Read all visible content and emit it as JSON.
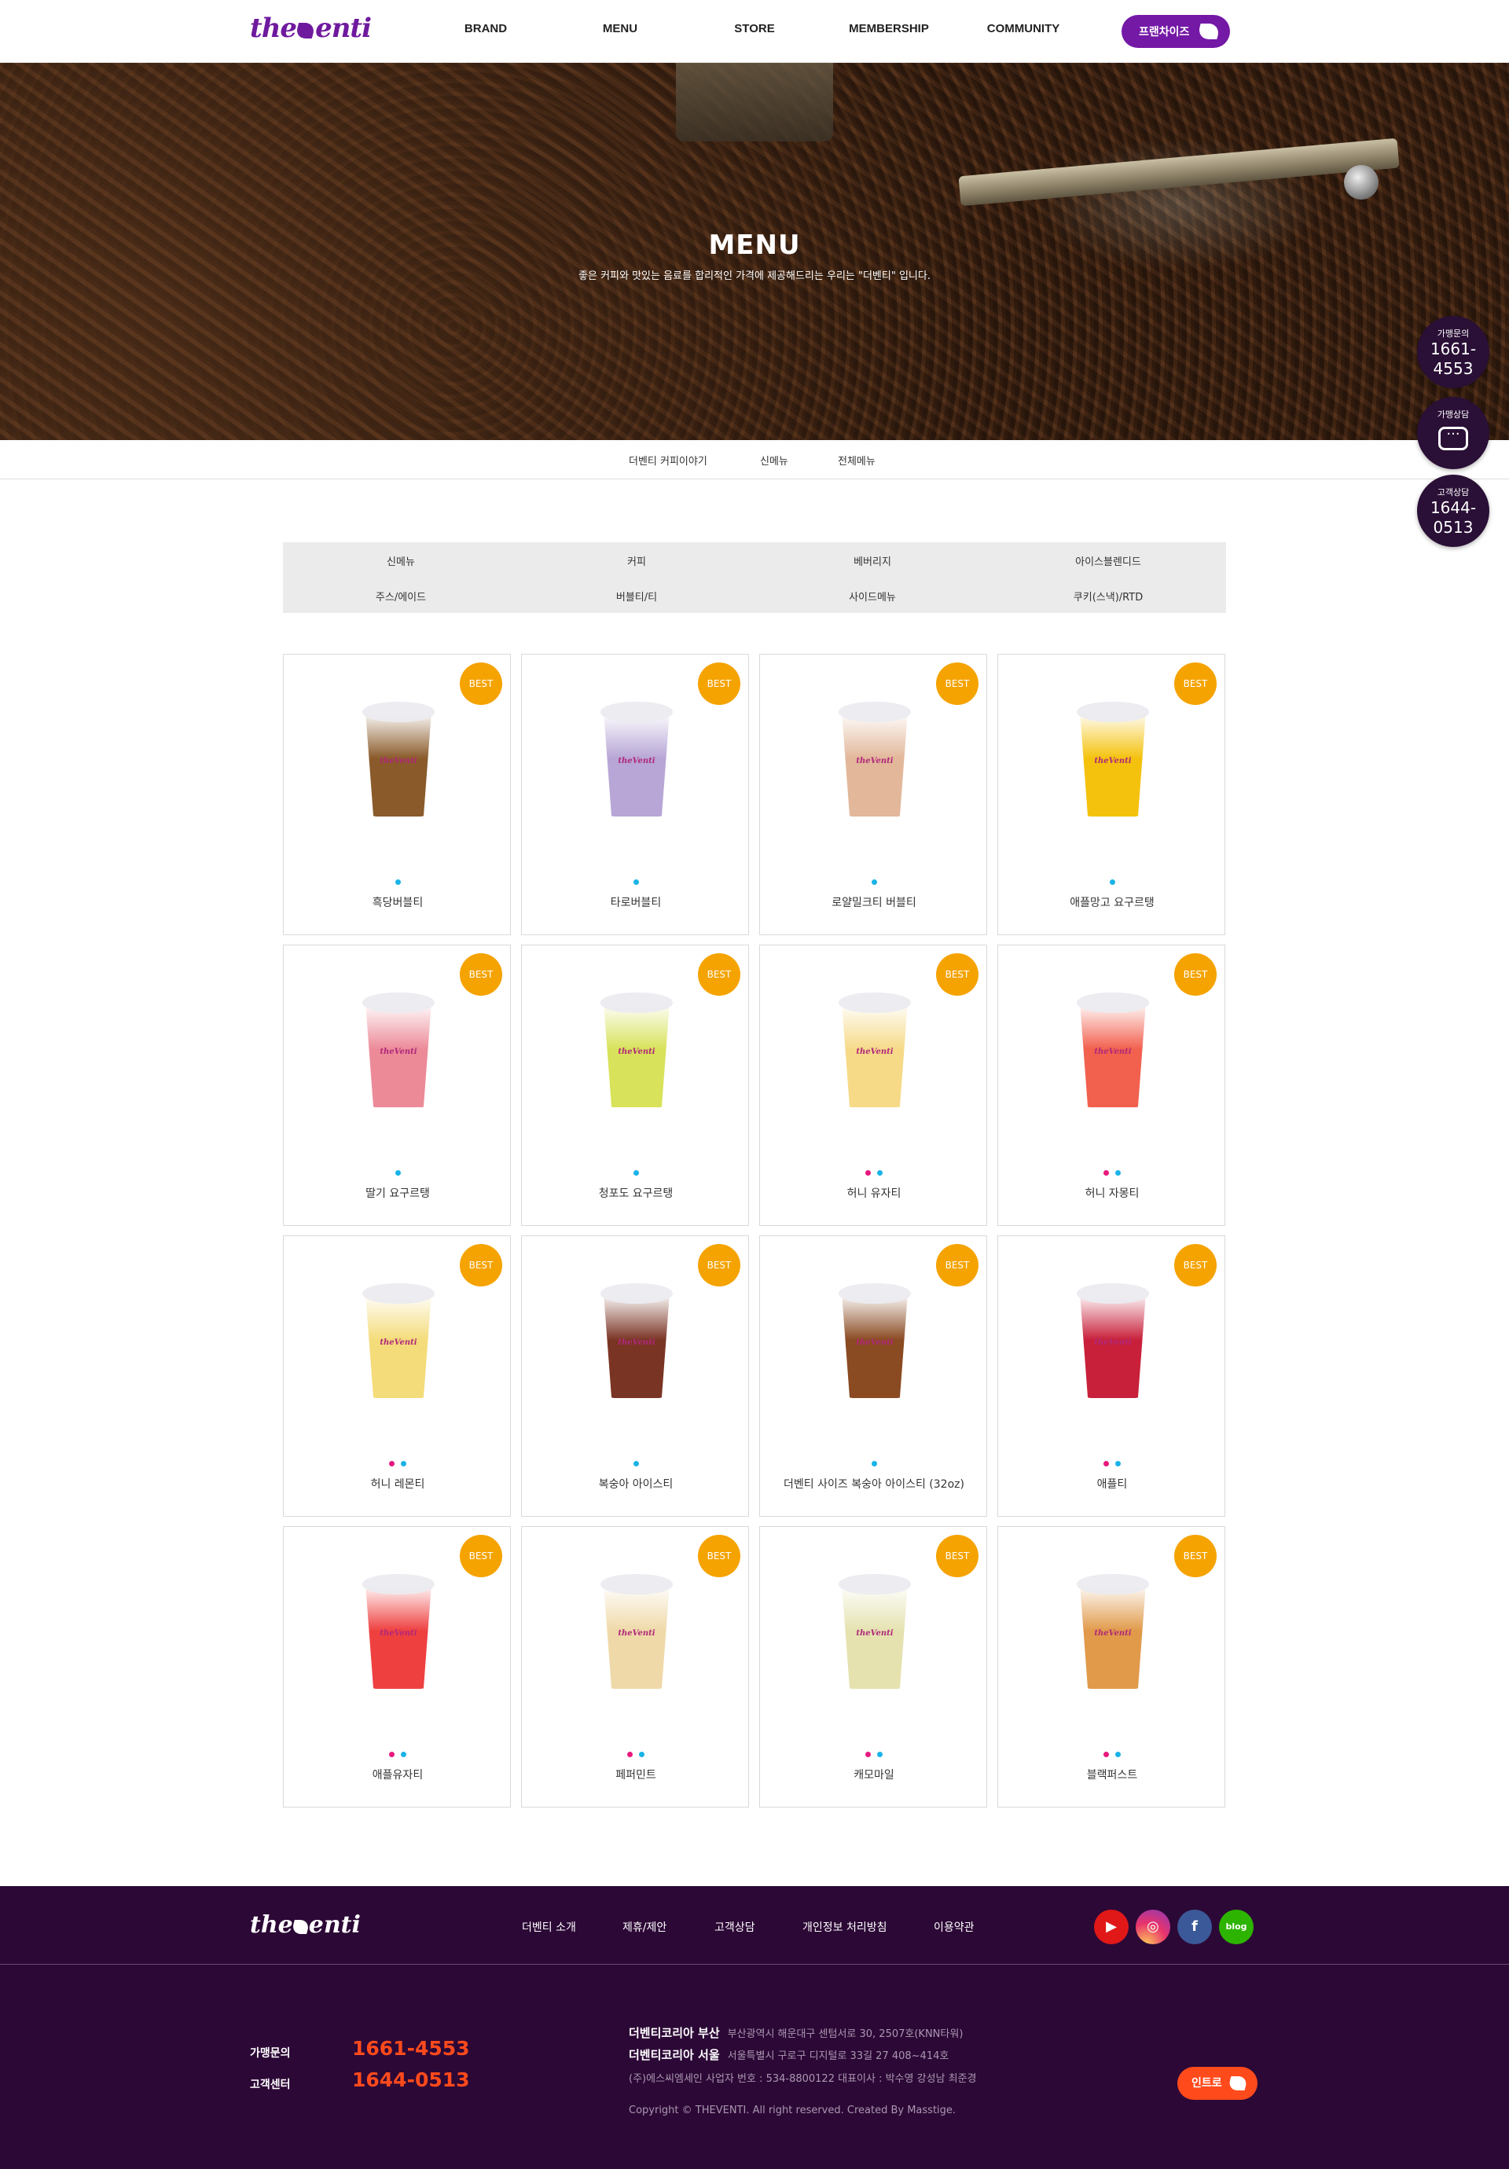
{
  "header": {
    "logo": "theVenti",
    "nav": [
      "BRAND",
      "MENU",
      "STORE",
      "MEMBERSHIP",
      "COMMUNITY"
    ],
    "franchise_label": "프랜차이즈"
  },
  "hero": {
    "title": "MENU",
    "subtitle": "좋은 커피와 맛있는 음료를 합리적인 가격에 제공해드리는 우리는 \"더벤티\" 입니다."
  },
  "floating": {
    "franchise_inquiry": {
      "label": "가맹문의",
      "number": "1661-4553"
    },
    "franchise_consult": {
      "label": "가맹상담"
    },
    "customer_consult": {
      "label": "고객상담",
      "number": "1644-0513"
    }
  },
  "subnav": [
    "더벤티 커피이야기",
    "신메뉴",
    "전체메뉴"
  ],
  "categories": [
    "신메뉴",
    "커피",
    "베버리지",
    "아이스블렌디드",
    "주스/에이드",
    "버블티/티",
    "사이드메뉴",
    "쿠키(스낵)/RTD"
  ],
  "badge_label": "BEST",
  "products": [
    {
      "name": "흑당버블티",
      "dots": [
        "blue"
      ],
      "color": "#8a5a2a"
    },
    {
      "name": "타로버블티",
      "dots": [
        "blue"
      ],
      "color": "#b7a6d6"
    },
    {
      "name": "로얄밀크티 버블티",
      "dots": [
        "blue"
      ],
      "color": "#e2b79a"
    },
    {
      "name": "애플망고 요구르탱",
      "dots": [
        "blue"
      ],
      "color": "#f4c20d"
    },
    {
      "name": "딸기 요구르탱",
      "dots": [
        "blue"
      ],
      "color": "#ec8a98"
    },
    {
      "name": "청포도 요구르탱",
      "dots": [
        "blue"
      ],
      "color": "#d8e25a"
    },
    {
      "name": "허니 유자티",
      "dots": [
        "pink",
        "blue"
      ],
      "color": "#f6da88"
    },
    {
      "name": "허니 자몽티",
      "dots": [
        "pink",
        "blue"
      ],
      "color": "#f2604e"
    },
    {
      "name": "허니 레몬티",
      "dots": [
        "pink",
        "blue"
      ],
      "color": "#f4dc7a"
    },
    {
      "name": "복숭아 아이스티",
      "dots": [
        "blue"
      ],
      "color": "#7a3424"
    },
    {
      "name": "더벤티 사이즈 복숭아 아이스티 (32oz)",
      "dots": [
        "blue"
      ],
      "color": "#8a4a22"
    },
    {
      "name": "애플티",
      "dots": [
        "pink",
        "blue"
      ],
      "color": "#c8203a"
    },
    {
      "name": "애플유자티",
      "dots": [
        "pink",
        "blue"
      ],
      "color": "#ef4040"
    },
    {
      "name": "페퍼민트",
      "dots": [
        "pink",
        "blue"
      ],
      "color": "#efd9a8"
    },
    {
      "name": "캐모마일",
      "dots": [
        "pink",
        "blue"
      ],
      "color": "#e5e2b0"
    },
    {
      "name": "블랙퍼스트",
      "dots": [
        "pink",
        "blue"
      ],
      "color": "#e19a4a"
    }
  ],
  "footer": {
    "logo": "theVenti",
    "links": [
      "더벤티 소개",
      "제휴/제안",
      "고객상담",
      "개인정보 처리방침",
      "이용약관"
    ],
    "social": [
      "youtube-icon",
      "instagram-icon",
      "facebook-icon",
      "blog-icon"
    ],
    "franchise_label": "가맹문의",
    "franchise_number": "1661-4553",
    "customer_label": "고객센터",
    "customer_number": "1644-0513",
    "busan_label": "더벤티코리아 부산",
    "busan_address": "부산광역시 해운대구 센텀서로 30, 2507호(KNN타워)",
    "seoul_label": "더벤티코리아 서울",
    "seoul_address": "서울특별시 구로구 디지털로 33길 27 408~414호",
    "company": "(주)에스씨엠세인   사업자 번호 : 534-8800122 대표이사 : 박수영 강성남 최준경",
    "copyright": "Copyright © THEVENTI. All right reserved. Created By Masstige.",
    "intro_label": "인트로"
  },
  "colors": {
    "brand": "#7418a6",
    "best": "#f5a300",
    "footer_bg": "#2c0836",
    "accent": "#ff4a1c"
  }
}
